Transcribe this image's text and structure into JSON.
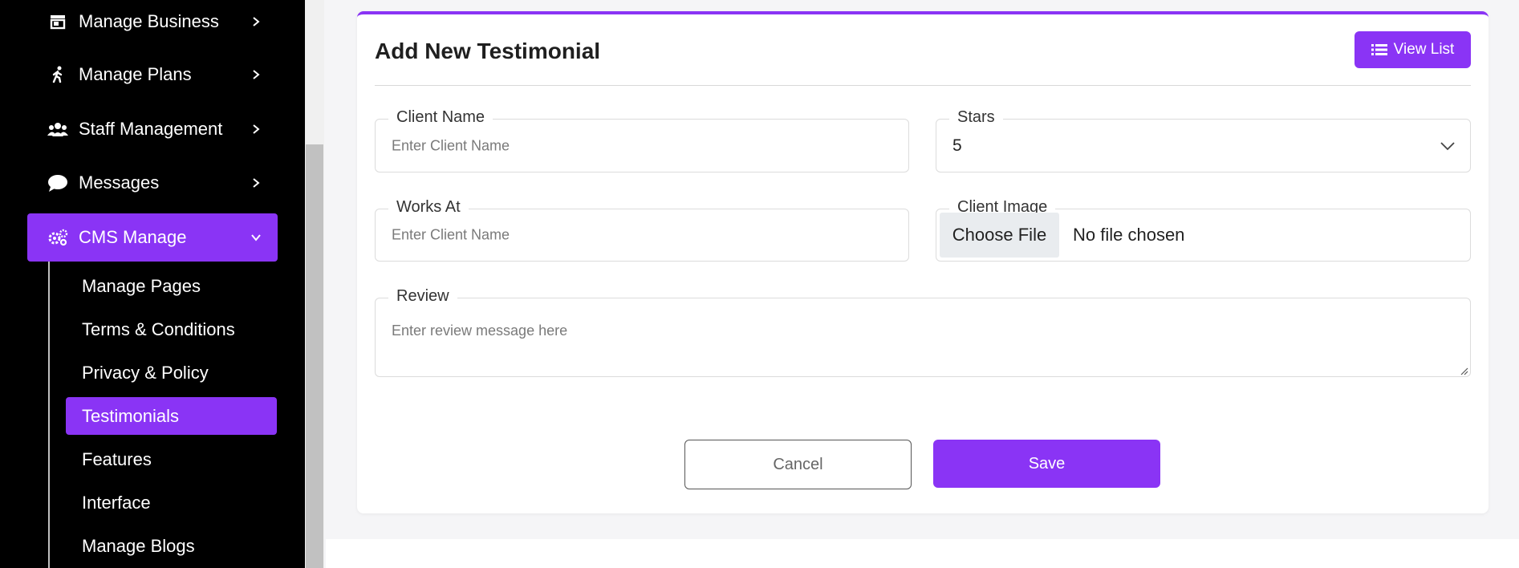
{
  "sidebar": {
    "items": [
      {
        "label": "Manage Business",
        "icon": "store-icon"
      },
      {
        "label": "Manage Plans",
        "icon": "walking-icon"
      },
      {
        "label": "Staff Management",
        "icon": "users-icon"
      },
      {
        "label": "Messages",
        "icon": "chat-icon"
      },
      {
        "label": "CMS Manage",
        "icon": "cogs-icon",
        "active": true
      }
    ],
    "subitems": [
      {
        "label": "Manage Pages"
      },
      {
        "label": "Terms & Conditions"
      },
      {
        "label": "Privacy & Policy"
      },
      {
        "label": "Testimonials",
        "active": true
      },
      {
        "label": "Features"
      },
      {
        "label": "Interface"
      },
      {
        "label": "Manage Blogs"
      }
    ]
  },
  "form": {
    "title": "Add New Testimonial",
    "view_list_label": "View List",
    "client_name": {
      "label": "Client Name",
      "placeholder": "Enter Client Name"
    },
    "stars": {
      "label": "Stars",
      "value": "5"
    },
    "works_at": {
      "label": "Works At",
      "placeholder": "Enter Client Name"
    },
    "client_image": {
      "label": "Client Image",
      "button": "Choose File",
      "status": "No file chosen"
    },
    "review": {
      "label": "Review",
      "placeholder": "Enter review message here"
    },
    "cancel_label": "Cancel",
    "save_label": "Save"
  },
  "colors": {
    "accent": "#8a34f5",
    "sidebar_bg": "#000000"
  }
}
